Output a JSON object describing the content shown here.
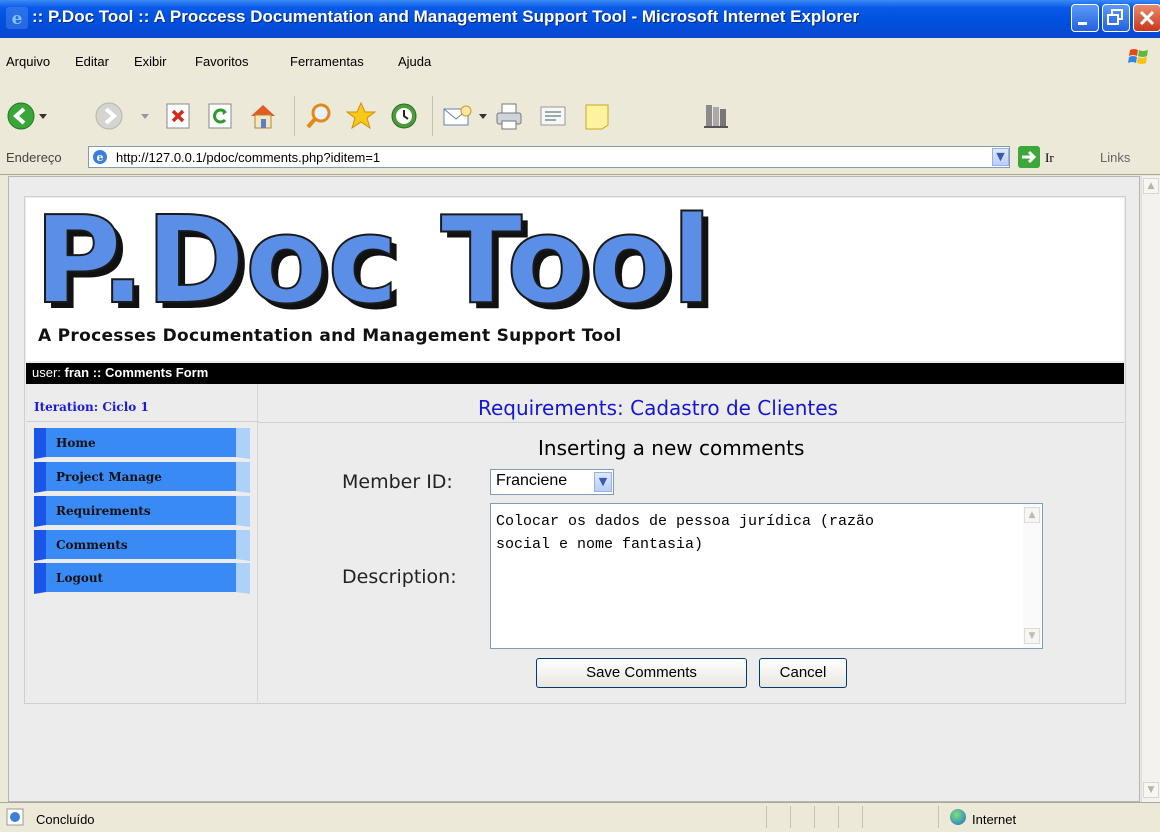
{
  "window": {
    "title": ":: P.Doc Tool :: A Proccess Documentation and Management Support Tool - Microsoft Internet Explorer"
  },
  "menu": [
    "Arquivo",
    "Editar",
    "Exibir",
    "Favoritos",
    "Ferramentas",
    "Ajuda"
  ],
  "address": {
    "label": "Endereço",
    "url": "http://127.0.0.1/pdoc/comments.php?iditem=1",
    "go_label": "Ir",
    "links_label": "Links"
  },
  "logo": {
    "main": "P.Doc Tool",
    "subtitle": "A Processes Documentation and Management Support Tool"
  },
  "userbar": {
    "prefix": "user:",
    "user": "fran",
    "separator": "::",
    "page": "Comments Form"
  },
  "sidebar": {
    "iteration": "Iteration: Ciclo 1",
    "items": [
      "Home",
      "Project Manage",
      "Requirements",
      "Comments",
      "Logout"
    ]
  },
  "main": {
    "title": "Requirements: Cadastro de Clientes",
    "form_heading": "Inserting a new comments",
    "member_label": "Member ID:",
    "member_value": "Franciene",
    "description_label": "Description:",
    "description_value": "Colocar os dados de pessoa jurídica (razão\nsocial e nome fantasia)",
    "save_label": "Save Comments",
    "cancel_label": "Cancel"
  },
  "status": {
    "text": "Concluído",
    "zone": "Internet"
  },
  "colors": {
    "titlebar": "#0050e0",
    "logo_blue": "#5b8ee6",
    "nav_blue": "#3a8af5",
    "heading_blue": "#1515d5"
  }
}
